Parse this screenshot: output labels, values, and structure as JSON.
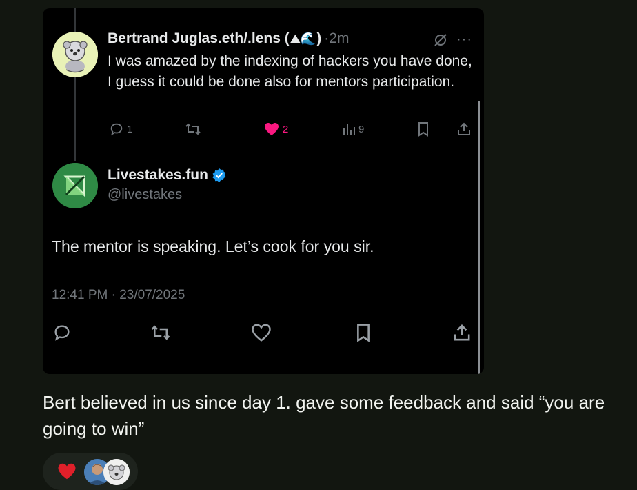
{
  "reply": {
    "author_name": "Bertrand Juglas.eth/.lens (",
    "author_emoji": "⛰🌊",
    "author_name_close": ")",
    "separator": "·",
    "time": "2m",
    "more_label": "···",
    "text": "I was amazed by the indexing of hackers you have done, I guess it could be done also for mentors participation.",
    "replies": "1",
    "likes": "2",
    "views": "9"
  },
  "main_post": {
    "author_name": "Livestakes.fun",
    "author_handle": "@livestakes",
    "text": "The mentor is speaking. Let’s cook for you sir.",
    "timestamp": "12:41 PM · 23/07/2025"
  },
  "caption": "Bert believed in us since day 1. gave some feedback and said “you are going to win”",
  "reactions": {
    "emoji": "❤️"
  },
  "colors": {
    "background": "#121610",
    "card": "#000000",
    "like_pink": "#f91880",
    "verified_blue": "#1d9bf0",
    "brand_green": "#2f8a45"
  },
  "icons": [
    "reply-icon",
    "retweet-icon",
    "heart-icon",
    "views-icon",
    "bookmark-icon",
    "share-icon",
    "grok-icon",
    "more-icon",
    "verified-badge-icon"
  ]
}
